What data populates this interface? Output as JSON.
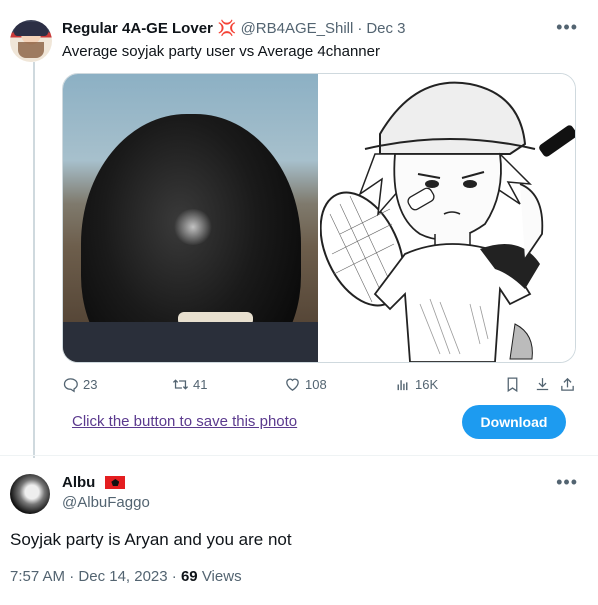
{
  "tweet": {
    "author_name": "Regular 4A-GE Lover",
    "author_emoji": "💢",
    "handle": "@RB4AGE_Shill",
    "separator": "·",
    "date": "Dec 3",
    "text": "Average soyjak party user vs Average 4channer",
    "stats": {
      "replies": "23",
      "retweets": "41",
      "likes": "108",
      "views": "16K"
    }
  },
  "save_bar": {
    "link_text": "Click the button to save this photo",
    "button_label": "Download"
  },
  "reply": {
    "author_name": "Albu",
    "handle": "@AlbuFaggo",
    "text": "Soyjak party is Aryan and you are not",
    "time": "7:57 AM",
    "separator": "·",
    "date": "Dec 14, 2023",
    "separator2": "·",
    "views_count": "69",
    "views_label": "Views"
  },
  "colors": {
    "accent": "#1d9bf0",
    "muted": "#536471",
    "link": "#5b3a8e"
  }
}
